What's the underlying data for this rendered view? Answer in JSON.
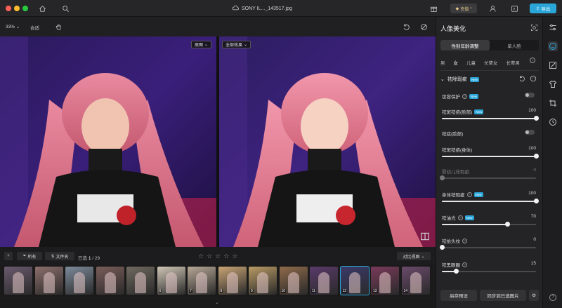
{
  "window": {
    "file_name": "SONY IL..._143517.jpg",
    "vip_label": "充值",
    "export_label": "导出"
  },
  "toolbar": {
    "zoom": "33%",
    "fit_label": "合适"
  },
  "canvas": {
    "left_tag": "原图",
    "right_tag": "全部效果"
  },
  "filterbar": {
    "all_label": "所有",
    "filename_label": "文件名",
    "selected_prefix": "已选",
    "selected_count": "1",
    "total_count": "/ 29",
    "view_label": "对比视图"
  },
  "filmstrip": {
    "thumbs": [
      {
        "num": ""
      },
      {
        "num": ""
      },
      {
        "num": ""
      },
      {
        "num": ""
      },
      {
        "num": ""
      },
      {
        "num": "6"
      },
      {
        "num": "7"
      },
      {
        "num": "8"
      },
      {
        "num": "9"
      },
      {
        "num": "10"
      },
      {
        "num": "11"
      },
      {
        "num": "12"
      },
      {
        "num": "13"
      },
      {
        "num": "14"
      }
    ],
    "selected_index": 11
  },
  "panel": {
    "title": "人像美化",
    "seg_tabs": [
      "性别年龄调整",
      "单人脸"
    ],
    "gender_tabs": [
      "男",
      "女",
      "儿童",
      "长辈女",
      "长辈男"
    ],
    "section_title": "祛除瑕疵",
    "new_badge": "New",
    "rows": [
      {
        "label": "妆容保护",
        "type": "toggle",
        "new": true,
        "help": true
      },
      {
        "label": "祛斑祛痘(脸部)",
        "type": "slider",
        "value": "100",
        "fraction": 1.0,
        "new": true
      },
      {
        "label": "祛痣(脸部)",
        "type": "toggle"
      },
      {
        "label": "祛斑祛痘(身体)",
        "type": "slider",
        "value": "100",
        "fraction": 1.0
      },
      {
        "label": "婴幼儿祛瑕疵",
        "type": "slider",
        "value": "0",
        "fraction": 0.0,
        "dim": true
      },
      {
        "label": "身体祛瑕疵",
        "type": "slider",
        "value": "100",
        "fraction": 1.0,
        "new": true,
        "help": true
      },
      {
        "label": "祛油光",
        "type": "slider",
        "value": "70",
        "fraction": 0.7,
        "new": true,
        "help": true
      },
      {
        "label": "祛抬头纹",
        "type": "slider",
        "value": "0",
        "fraction": 0.0,
        "help": true
      },
      {
        "label": "祛黑眼圈",
        "type": "slider",
        "value": "15",
        "fraction": 0.15,
        "help": true
      }
    ],
    "save_preset_label": "另存预设",
    "sync_label": "同步到已选图片"
  }
}
